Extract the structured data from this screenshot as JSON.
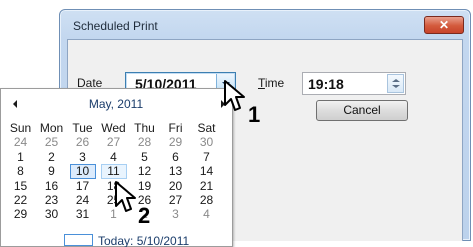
{
  "dialog": {
    "title": "Scheduled Print",
    "close_label": "✕",
    "date_label_accel": "D",
    "date_label_rest": "ate",
    "date_value": "5/10/2011",
    "time_label_accel": "T",
    "time_label_rest": "ime",
    "time_value": "19:18",
    "cancel_label": "Cancel"
  },
  "calendar": {
    "month_title": "May, 2011",
    "weekdays": [
      "Sun",
      "Mon",
      "Tue",
      "Wed",
      "Thu",
      "Fri",
      "Sat"
    ],
    "weeks": [
      [
        "24",
        "25",
        "26",
        "27",
        "28",
        "29",
        "30"
      ],
      [
        "1",
        "2",
        "3",
        "4",
        "5",
        "6",
        "7"
      ],
      [
        "8",
        "9",
        "10",
        "11",
        "12",
        "13",
        "14"
      ],
      [
        "15",
        "16",
        "17",
        "18",
        "19",
        "20",
        "21"
      ],
      [
        "22",
        "23",
        "24",
        "25",
        "26",
        "27",
        "28"
      ],
      [
        "29",
        "30",
        "31",
        "1",
        "2",
        "3",
        "4"
      ]
    ],
    "today_text": "Today: 5/10/2011"
  },
  "steps": {
    "step1": "1",
    "step2": "2"
  },
  "icons": {
    "close": "close-icon",
    "dropdown": "chevron-down-icon",
    "spinner": "spinner-icon",
    "prev": "chevron-left-icon",
    "next": "chevron-right-icon",
    "pointer": "mouse-pointer-icon"
  }
}
